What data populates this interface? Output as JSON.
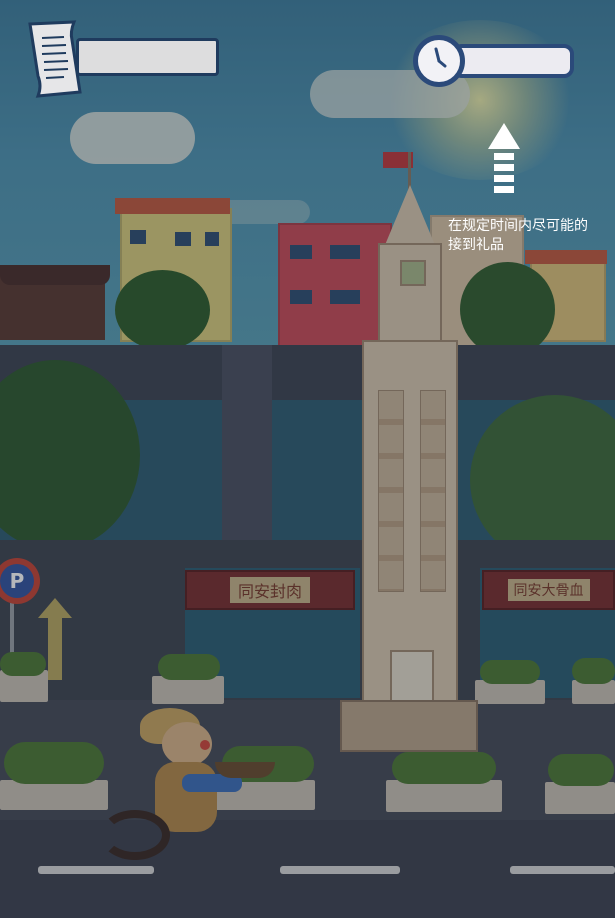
{
  "hud": {
    "score_value": "",
    "timer_value": "",
    "hint_text": "在规定时间内尽可能的接到礼品"
  },
  "scene": {
    "shop_sign_left": "同安封肉",
    "shop_sign_right": "同安大骨血",
    "parking_sign": "P"
  },
  "icons": {
    "scroll": "scroll-icon",
    "clock": "clock-icon",
    "arrow": "up-arrow-icon"
  },
  "colors": {
    "hud_border": "#2b4a7a",
    "hint_text": "#ffffff"
  }
}
